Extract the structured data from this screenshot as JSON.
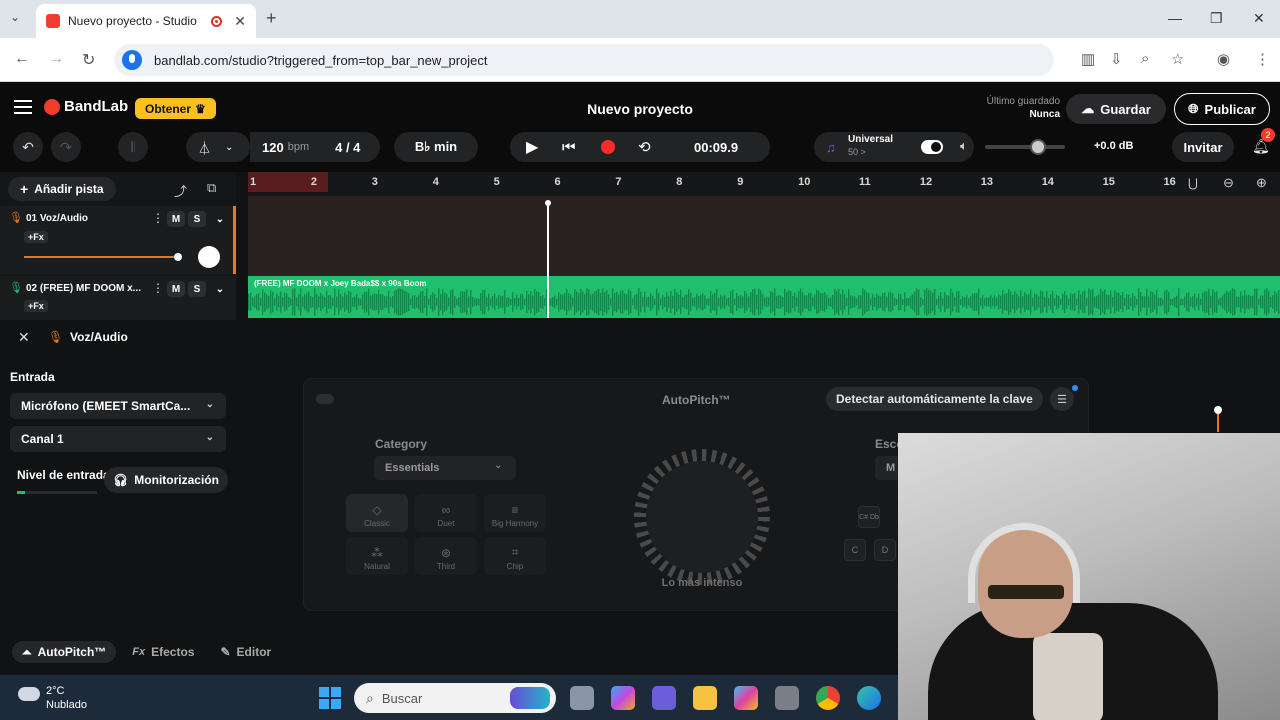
{
  "browser": {
    "tab_title": "Nuevo proyecto - Studio",
    "new_tab": "+",
    "url": "bandlab.com/studio?triggered_from=top_bar_new_project"
  },
  "header": {
    "brand": "BandLab",
    "get_label": "Obtener",
    "project_title": "Nuevo proyecto",
    "last_saved_label": "Último guardado",
    "last_saved_value": "Nunca",
    "save_label": "Guardar",
    "publish_label": "Publicar"
  },
  "transport": {
    "tempo": "120",
    "tempo_unit": "bpm",
    "time_signature": "4 / 4",
    "key": "B♭ min",
    "time": "00:09.9",
    "preset_name": "Universal",
    "preset_sub": "50 >",
    "volume_db": "+0.0 dB",
    "invite_label": "Invitar",
    "notifications_count": "2"
  },
  "tracks": {
    "add_label": "Añadir pista",
    "mute_label": "M",
    "solo_label": "S",
    "fx_label": "+Fx",
    "items": [
      {
        "name": "01  Voz/Audio"
      },
      {
        "name": "02  (FREE) MF DOOM x..."
      }
    ],
    "clip_title": "(FREE) MF DOOM x Joey Bada$$ x 90s Boom"
  },
  "ruler": {
    "bars": [
      "1",
      "2",
      "3",
      "4",
      "5",
      "6",
      "7",
      "8",
      "9",
      "10",
      "11",
      "12",
      "13",
      "14",
      "15",
      "16"
    ]
  },
  "panel": {
    "title": "Voz/Audio",
    "input_label": "Entrada",
    "input_device": "Micrófono (EMEET SmartCa...",
    "channel": "Canal 1",
    "level_label": "Nivel de entrada",
    "monitor_label": "Monitorización",
    "autopitch": {
      "title": "AutoPitch™",
      "detect_label": "Detectar automáticamente la clave",
      "category_label": "Category",
      "category_value": "Essentials",
      "presets": [
        "Classic",
        "Duet",
        "Big Harmony",
        "Natural",
        "Third",
        "Chip"
      ],
      "knob_label": "Lo más intenso",
      "scale_label": "Esco",
      "scale_value": "M",
      "keys": [
        "C",
        "D",
        "C#\nDb"
      ]
    },
    "tabs": [
      "AutoPitch™",
      "Efectos",
      "Editor"
    ],
    "tab_prefix_fx": "Fx"
  },
  "taskbar": {
    "temperature": "2°C",
    "weather": "Nublado",
    "search_placeholder": "Buscar"
  },
  "colors": {
    "brand": "#f23d2e",
    "get_button": "#ffbf1f",
    "audio_clip": "#1fbf6e",
    "record": "#ff2a2a"
  }
}
